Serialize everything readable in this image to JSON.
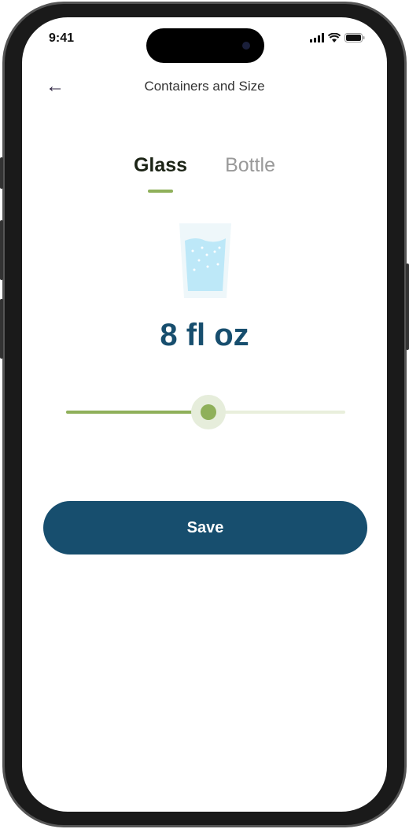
{
  "status_bar": {
    "time": "9:41",
    "icons": [
      "signal-icon",
      "wifi-icon",
      "battery-icon"
    ]
  },
  "header": {
    "title": "Containers and Size",
    "back_icon": "arrow-left-icon"
  },
  "tabs": [
    {
      "label": "Glass",
      "active": true
    },
    {
      "label": "Bottle",
      "active": false
    }
  ],
  "container": {
    "icon": "water-glass-icon",
    "amount": "8 fl oz"
  },
  "slider": {
    "value_fraction": 0.51
  },
  "actions": {
    "save_label": "Save"
  },
  "colors": {
    "primary": "#174e6e",
    "accent": "#8fb05a"
  }
}
